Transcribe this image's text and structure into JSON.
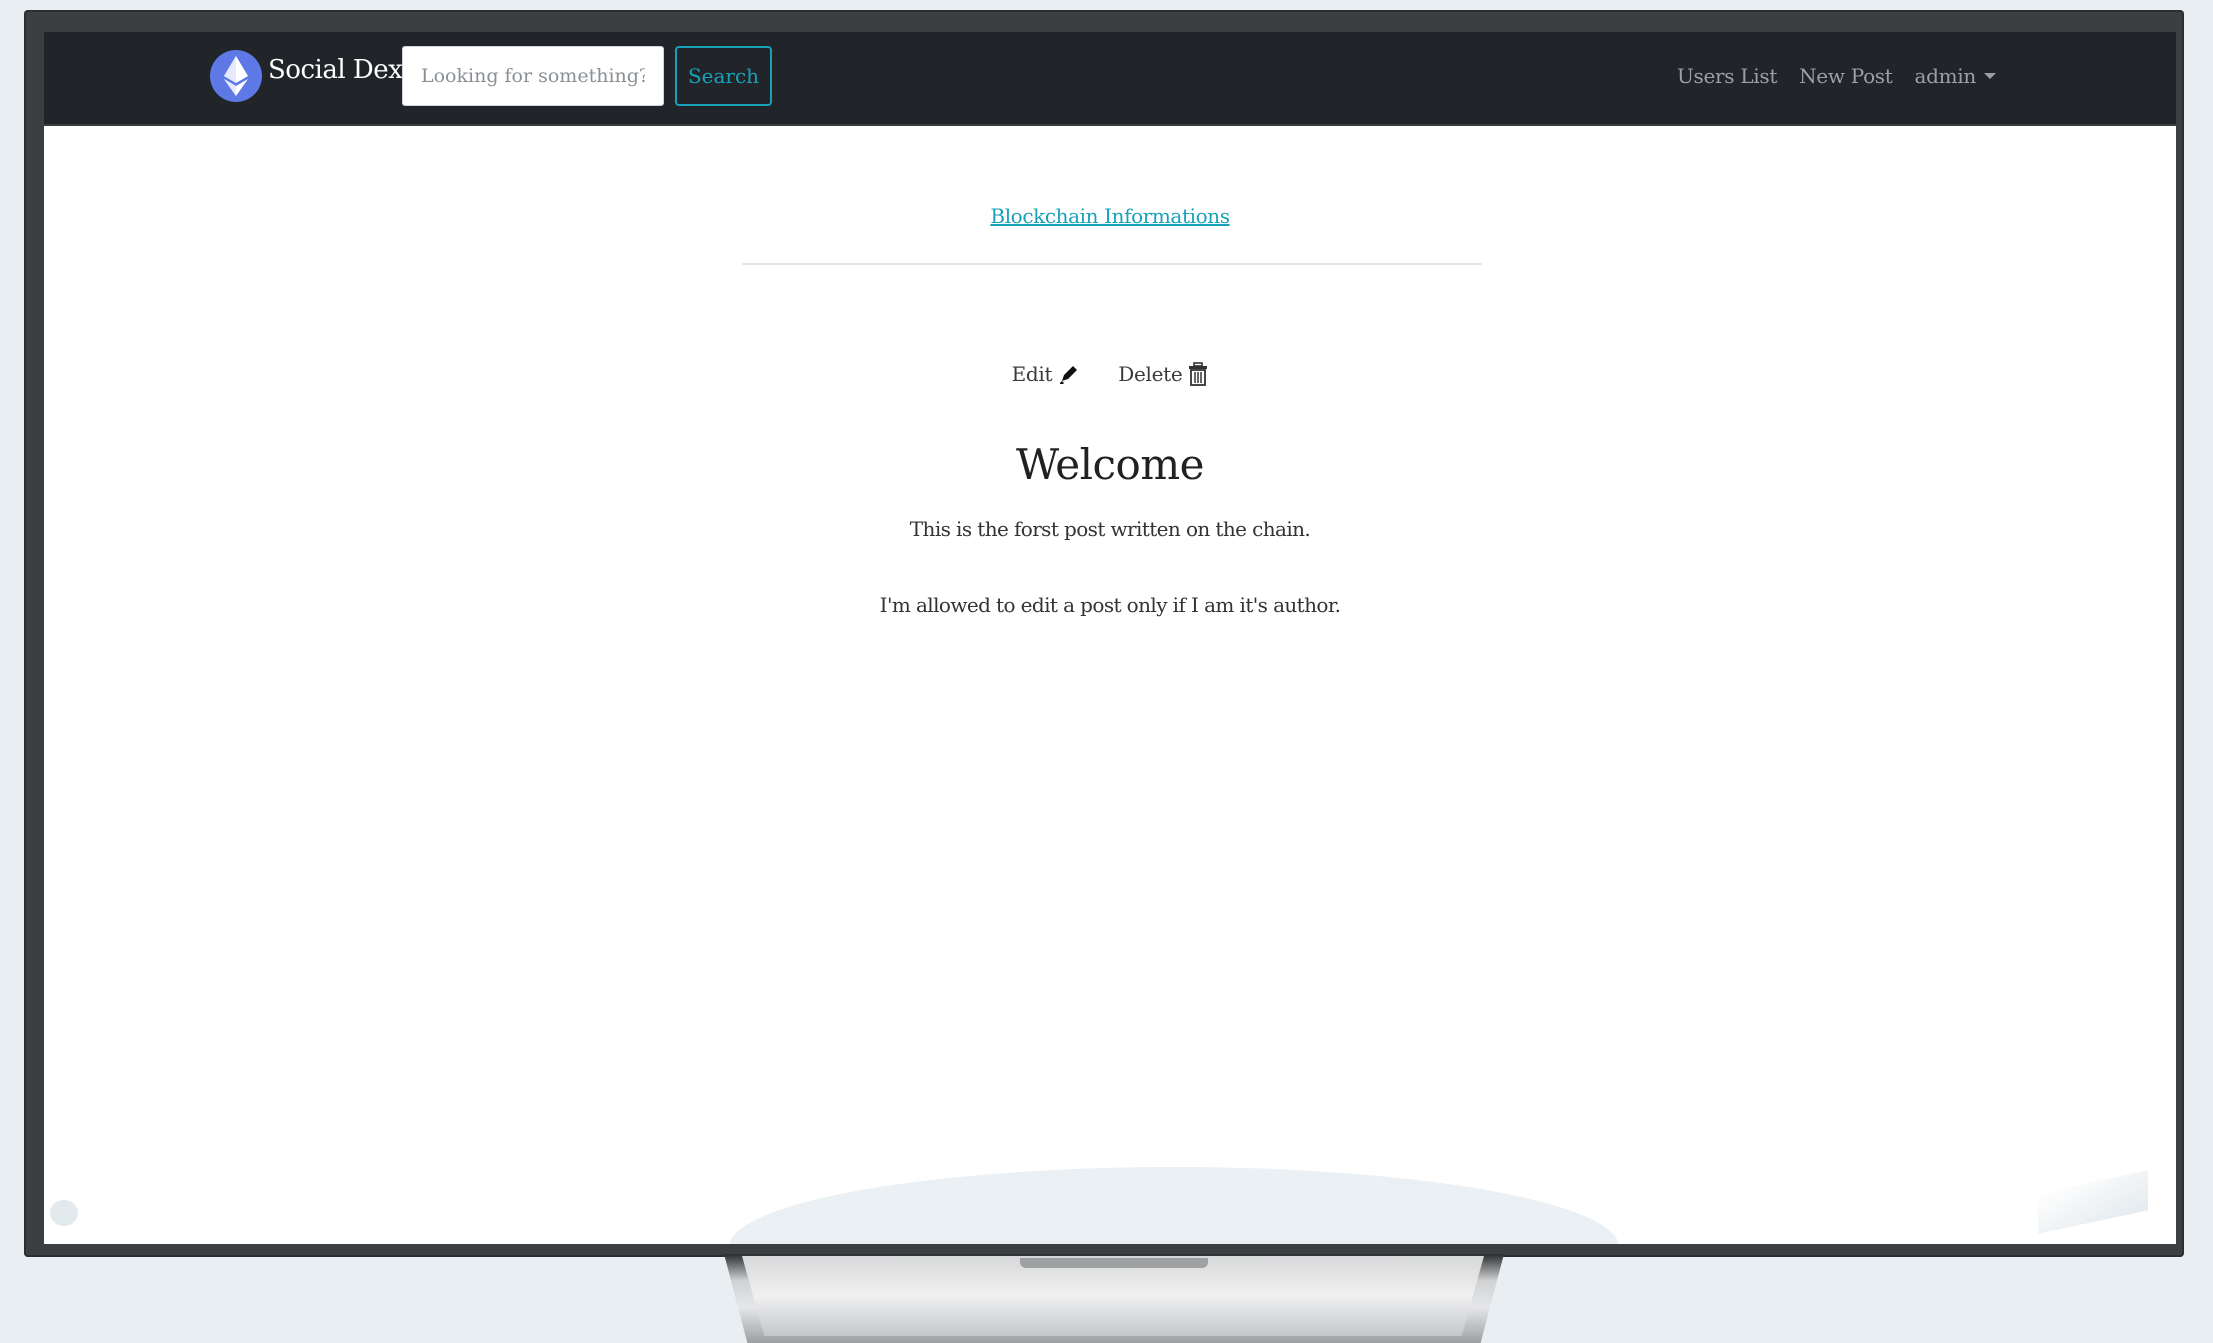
{
  "navbar": {
    "brand": "Social Dex",
    "search_placeholder": "Looking for something?",
    "search_button": "Search",
    "links": {
      "users_list": "Users List",
      "new_post": "New Post",
      "account": "admin"
    }
  },
  "page": {
    "blockchain_link": "Blockchain Informations",
    "actions": {
      "edit": "Edit",
      "delete": "Delete"
    },
    "post": {
      "title": "Welcome",
      "lines": [
        "This is the forst post written on the chain.",
        "I'm allowed to edit a post only if I am it's author."
      ]
    }
  },
  "colors": {
    "navbar_bg": "#212529",
    "accent": "#17a2b8",
    "brand_logo": "#5e78e6"
  },
  "icons": {
    "brand": "ethereum-icon",
    "edit": "pencil-icon",
    "delete": "trash-icon",
    "dropdown": "caret-down-icon"
  }
}
